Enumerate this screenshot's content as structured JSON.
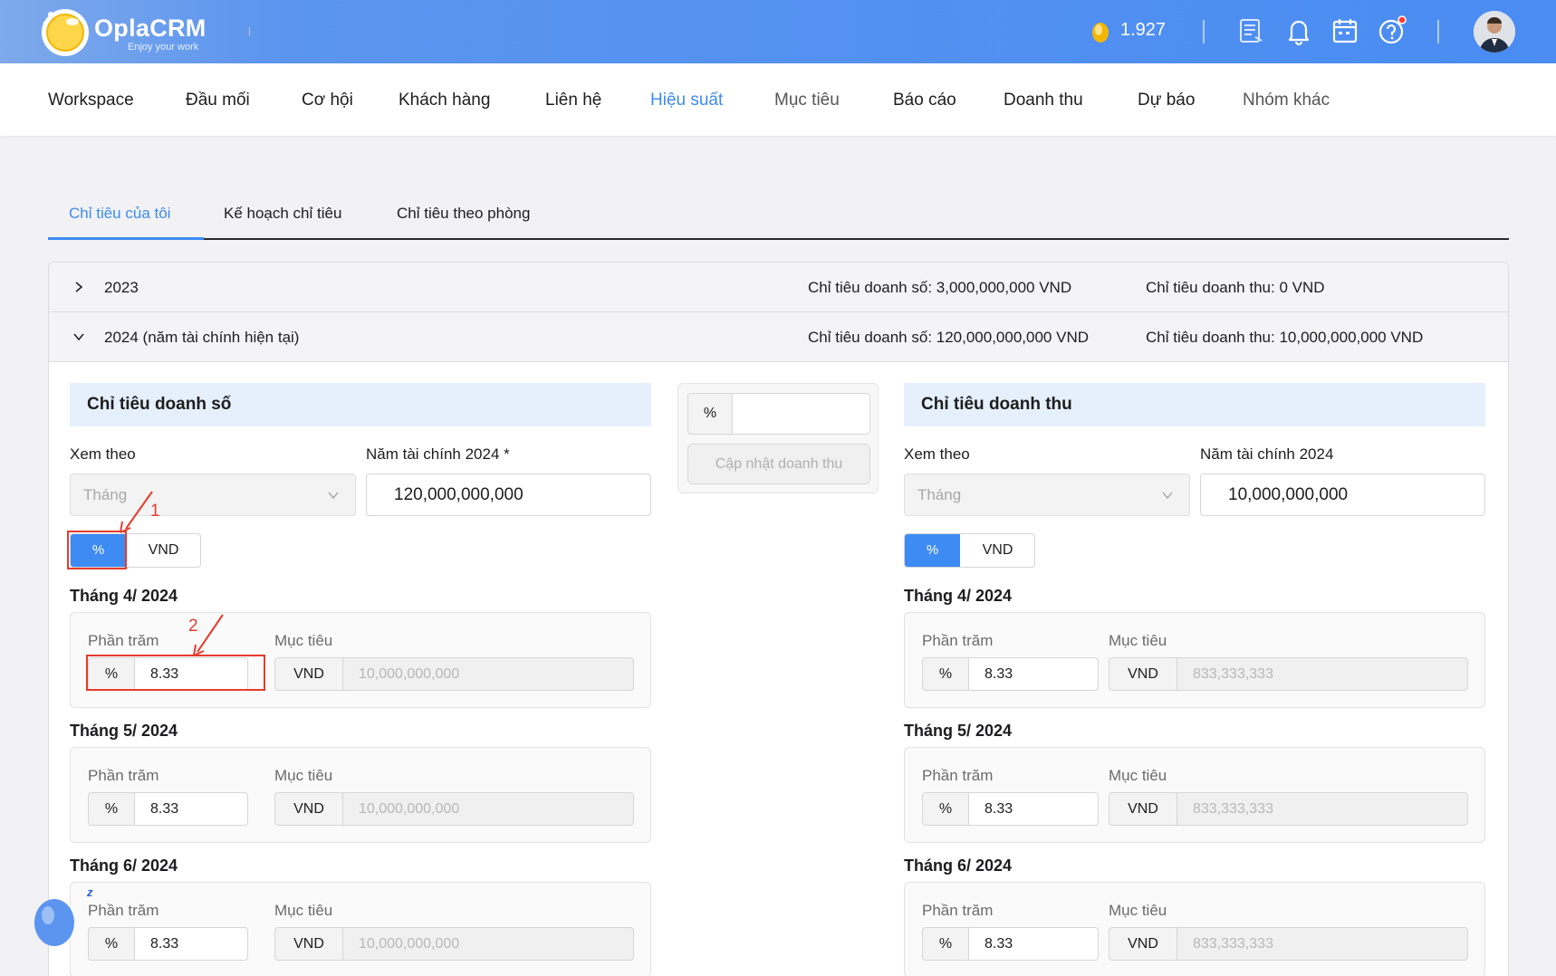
{
  "header": {
    "brand": "OplaCRM",
    "tagline": "Enjoy your work",
    "coins": "1.927",
    "colors": {
      "bar": "#4a8cf2",
      "accent": "#3d8bf3",
      "annotation": "#e53c2c"
    },
    "icons": [
      "coin-icon",
      "report-icon",
      "bell-icon",
      "calendar-icon",
      "help-icon",
      "avatar"
    ]
  },
  "nav": {
    "items": [
      "Workspace",
      "Đầu mối",
      "Cơ hội",
      "Khách hàng",
      "Liên hệ",
      "Hiệu suất",
      "Mục tiêu",
      "Báo cáo",
      "Doanh thu",
      "Dự báo",
      "Nhóm khác"
    ],
    "active": "Hiệu suất"
  },
  "subtabs": [
    "Chỉ tiêu của tôi",
    "Kế hoạch chỉ tiêu",
    "Chỉ tiêu theo phòng"
  ],
  "years": [
    {
      "label": "2023",
      "sales_target": "Chỉ tiêu doanh số: 3,000,000,000 VND",
      "revenue_target": "Chỉ tiêu doanh thu: 0 VND"
    },
    {
      "label": "2024 (năm tài chính hiện tại)",
      "sales_target": "Chỉ tiêu doanh số: 120,000,000,000 VND",
      "revenue_target": "Chỉ tiêu doanh thu: 10,000,000,000 VND"
    }
  ],
  "middle": {
    "pct_addon": "%",
    "input": "",
    "button": "Cập nhật doanh thu"
  },
  "sales": {
    "title": "Chỉ tiêu doanh số",
    "view_by_label": "Xem theo",
    "view_by_value": "Tháng",
    "fy_label": "Năm tài chính 2024 *",
    "fy_value": "120,000,000,000",
    "toggle_pct": "%",
    "toggle_vnd": "VND",
    "pct_label": "Phần trăm",
    "target_label": "Mục tiêu",
    "pct_addon": "%",
    "vnd_addon": "VND",
    "months": [
      {
        "title": "Tháng 4/ 2024",
        "pct": "8.33",
        "target": "10,000,000,000"
      },
      {
        "title": "Tháng 5/ 2024",
        "pct": "8.33",
        "target": "10,000,000,000"
      },
      {
        "title": "Tháng 6/ 2024",
        "pct": "8.33",
        "target": "10,000,000,000"
      }
    ]
  },
  "revenue": {
    "title": "Chỉ tiêu doanh thu",
    "view_by_label": "Xem theo",
    "view_by_value": "Tháng",
    "fy_label": "Năm tài chính 2024",
    "fy_value": "10,000,000,000",
    "toggle_pct": "%",
    "toggle_vnd": "VND",
    "pct_label": "Phần trăm",
    "target_label": "Mục tiêu",
    "pct_addon": "%",
    "vnd_addon": "VND",
    "months": [
      {
        "title": "Tháng 4/ 2024",
        "pct": "8.33",
        "target": "833,333,333"
      },
      {
        "title": "Tháng 5/ 2024",
        "pct": "8.33",
        "target": "833,333,333"
      },
      {
        "title": "Tháng 6/ 2024",
        "pct": "8.33",
        "target": "833,333,333"
      }
    ]
  },
  "annotations": {
    "one": "1",
    "two": "2"
  },
  "mascot": {
    "snore": "z"
  }
}
